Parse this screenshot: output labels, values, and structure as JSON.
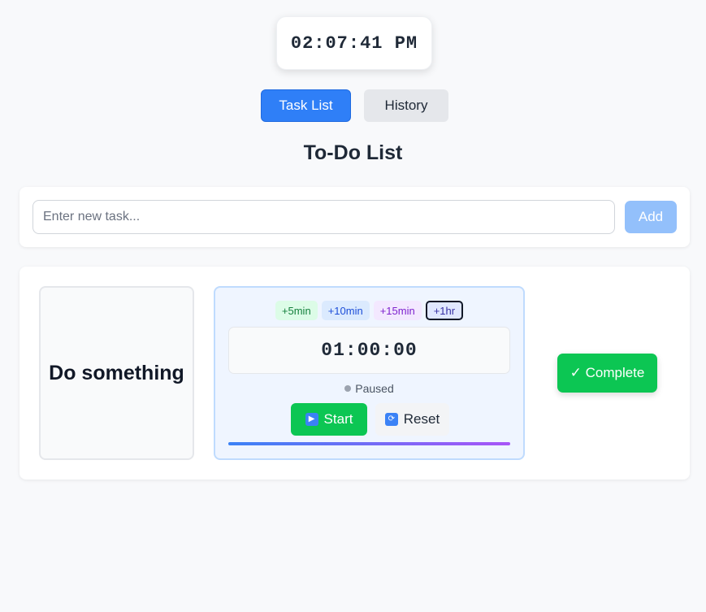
{
  "clock": {
    "time": "02:07:41 PM"
  },
  "tabs": [
    {
      "label": "Task List",
      "active": true
    },
    {
      "label": "History",
      "active": false
    }
  ],
  "page": {
    "title": "To-Do List"
  },
  "new_task": {
    "placeholder": "Enter new task...",
    "value": "",
    "add_label": "Add"
  },
  "tasks": [
    {
      "name": "Do something",
      "timer": {
        "increments": [
          "+5min",
          "+10min",
          "+15min",
          "+1hr"
        ],
        "display": "01:00:00",
        "status": "Paused",
        "start_label": "Start",
        "reset_label": "Reset",
        "progress": 1.0
      },
      "complete_label": "✓ Complete"
    }
  ],
  "colors": {
    "accent": "#2f7ff7",
    "success": "#0cc653",
    "background": "#f8f9fb"
  }
}
